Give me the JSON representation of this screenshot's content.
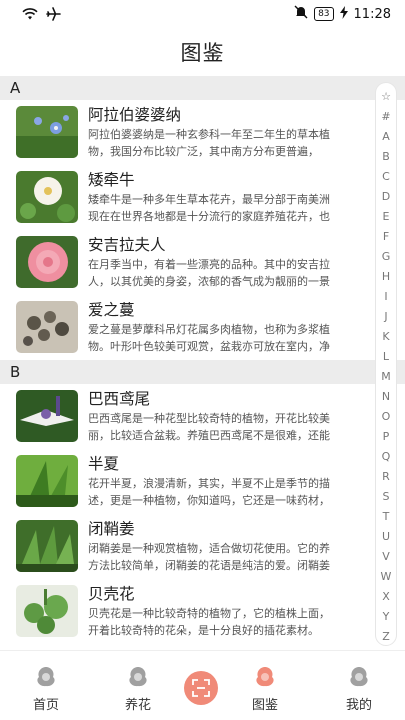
{
  "status_bar": {
    "battery": "83",
    "time": "11:28"
  },
  "header": {
    "title": "图鉴"
  },
  "sections": [
    {
      "letter": "A",
      "items": [
        {
          "name": "阿拉伯婆婆纳",
          "desc1": "阿拉伯婆婆纳是一种玄参科一年至二年生的草本植",
          "desc2": "物，我国分布比较广泛，其中南方分布更普遍，",
          "image": "blue-flower-image"
        },
        {
          "name": "矮牵牛",
          "desc1": "矮牵牛是一种多年生草本花卉，最早分部于南美洲",
          "desc2": "现在在世界各地都是十分流行的家庭养殖花卉，也",
          "image": "white-petunia-image"
        },
        {
          "name": "安吉拉夫人",
          "desc1": "在月季当中，有着一些漂亮的品种。其中的安吉拉",
          "desc2": "人，以其优美的身姿，浓郁的香气成为靓丽的一景",
          "image": "pink-rose-image"
        },
        {
          "name": "爱之蔓",
          "desc1": "爱之蔓是萝藦科吊灯花属多肉植物，也称为多浆植",
          "desc2": "物。叶形叶色较美可观赏，盆栽亦可放在室内，净",
          "image": "succulent-image"
        }
      ]
    },
    {
      "letter": "B",
      "items": [
        {
          "name": "巴西鸢尾",
          "desc1": "巴西鸢尾是一种花型比较奇特的植物，开花比较美",
          "desc2": "丽，比较适合盆栽。养殖巴西鸢尾不是很难，还能",
          "image": "iris-image"
        },
        {
          "name": "半夏",
          "desc1": "花开半夏，浪漫清新，其实，半夏不止是季节的描",
          "desc2": "述，更是一种植物，你知道吗，它还是一味药材，",
          "image": "pinellia-image"
        },
        {
          "name": "闭鞘姜",
          "desc1": "闭鞘姜是一种观赏植物，适合做切花使用。它的养",
          "desc2": "方法比较简单，闭鞘姜的花语是纯洁的爱。闭鞘姜",
          "image": "costus-image"
        },
        {
          "name": "贝壳花",
          "desc1": "贝壳花是一种比较奇特的植物了，它的植株上面，",
          "desc2": "开着比较奇特的花朵，是十分良好的插花素材。",
          "image": "shell-flower-image"
        }
      ]
    }
  ],
  "index_bar": [
    "☆",
    "#",
    "A",
    "B",
    "C",
    "D",
    "E",
    "F",
    "G",
    "H",
    "I",
    "J",
    "K",
    "L",
    "M",
    "N",
    "O",
    "P",
    "Q",
    "R",
    "S",
    "T",
    "U",
    "V",
    "W",
    "X",
    "Y",
    "Z"
  ],
  "tabs": [
    {
      "label": "首页",
      "active": false
    },
    {
      "label": "养花",
      "active": false
    },
    {
      "label": "图鉴",
      "active": true
    },
    {
      "label": "我的",
      "active": false
    }
  ],
  "colors": {
    "accent": "#f08a78",
    "section_bg": "#ececec",
    "tab_icon_gray": "#9a9a9a"
  }
}
